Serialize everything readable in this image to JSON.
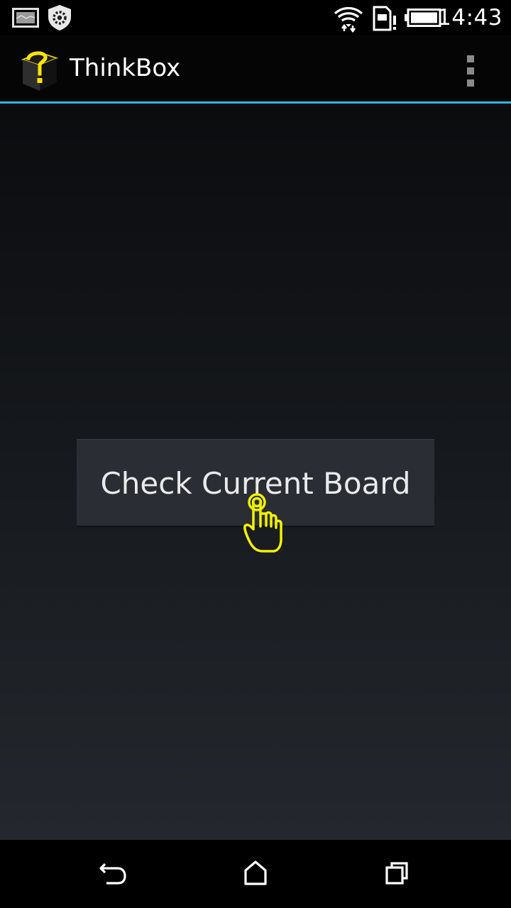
{
  "status_bar": {
    "time": "14:43",
    "icons": [
      "image-notification-icon",
      "settings-notification-icon",
      "wifi-icon",
      "sim-card-alert-icon",
      "battery-full-icon"
    ]
  },
  "action_bar": {
    "title": "ThinkBox",
    "logo": "thinkbox-logo-icon",
    "menu": "overflow-menu-icon",
    "accent_color": "#33b5e5"
  },
  "main": {
    "button_label": "Check Current Board"
  },
  "touch_indicator": {
    "icon": "tap-hand-icon",
    "color": "#f2f200"
  },
  "nav_bar": {
    "buttons": [
      "back-icon",
      "home-icon",
      "recent-apps-icon"
    ]
  }
}
